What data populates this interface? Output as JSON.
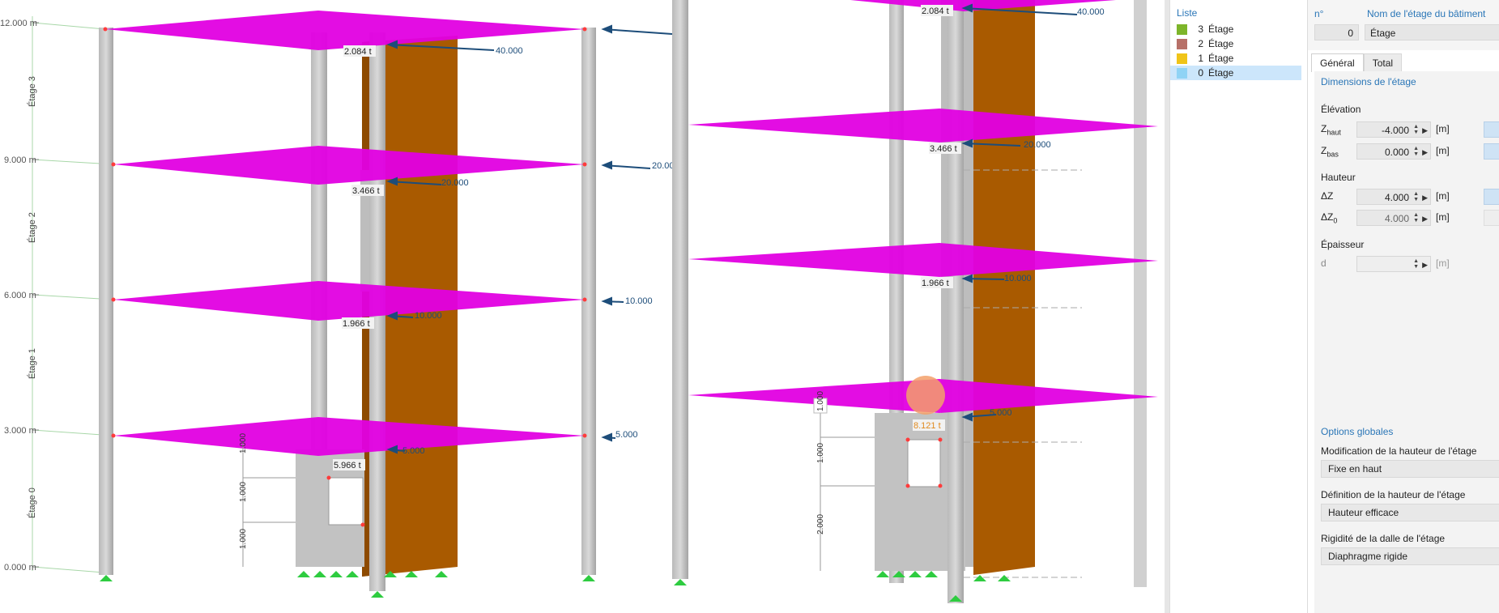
{
  "left_view": {
    "elevations": [
      "12.000 m",
      "9.000 m",
      "6.000 m",
      "3.000 m",
      "0.000 m"
    ],
    "story_labels": [
      "Étage 3",
      "Étage 2",
      "Étage 1",
      "Étage 0"
    ],
    "masses": [
      "2.084 t",
      "3.466 t",
      "1.966 t",
      "5.966 t"
    ],
    "loads": [
      "40.000",
      "20.000",
      "10.000",
      "5.000"
    ],
    "edge_loads": [
      "20.00",
      "10.000",
      "5.000"
    ],
    "dimensions": [
      "1.000",
      "1.000",
      "1.000"
    ]
  },
  "right_view": {
    "masses": [
      "2.084 t",
      "3.466 t",
      "1.966 t",
      "8.121 t"
    ],
    "loads": [
      "40.000",
      "20.000",
      "10.000",
      "5.000"
    ],
    "dimensions": [
      "1.000",
      "1.000",
      "2.000"
    ]
  },
  "list": {
    "title": "Liste",
    "items": [
      {
        "num": "3",
        "name": "Étage",
        "color": "#7db52a"
      },
      {
        "num": "2",
        "name": "Étage",
        "color": "#b77068"
      },
      {
        "num": "1",
        "name": "Étage",
        "color": "#f0c419"
      },
      {
        "num": "0",
        "name": "Étage",
        "color": "#8fd3f5"
      }
    ],
    "selected_index": 3
  },
  "props": {
    "no_caption": "n°",
    "no_value": "0",
    "name_caption": "Nom de l'étage du bâtiment",
    "name_value": "Étage",
    "tabs": [
      "Général",
      "Total"
    ],
    "dim_section": "Dimensions de l'étage",
    "elevation_title": "Élévation",
    "z_top_label": "Z",
    "z_top_sub": "haut",
    "z_top_value": "-4.000",
    "z_bot_label": "Z",
    "z_bot_sub": "bas",
    "z_bot_value": "0.000",
    "unit_m": "[m]",
    "height_title": "Hauteur",
    "dz_label": "ΔZ",
    "dz_value": "4.000",
    "dz0_label": "ΔZ",
    "dz0_sub": "0",
    "dz0_value": "4.000",
    "thickness_title": "Épaisseur",
    "d_label": "d",
    "d_value": "",
    "global_section": "Options globales",
    "opt1_label": "Modification de la hauteur de l'étage",
    "opt1_value": "Fixe en haut",
    "opt2_label": "Définition de la hauteur de l'étage",
    "opt2_value": "Hauteur efficace",
    "opt3_label": "Rigidité de la dalle de l'étage",
    "opt3_value": "Diaphragme rigide"
  }
}
